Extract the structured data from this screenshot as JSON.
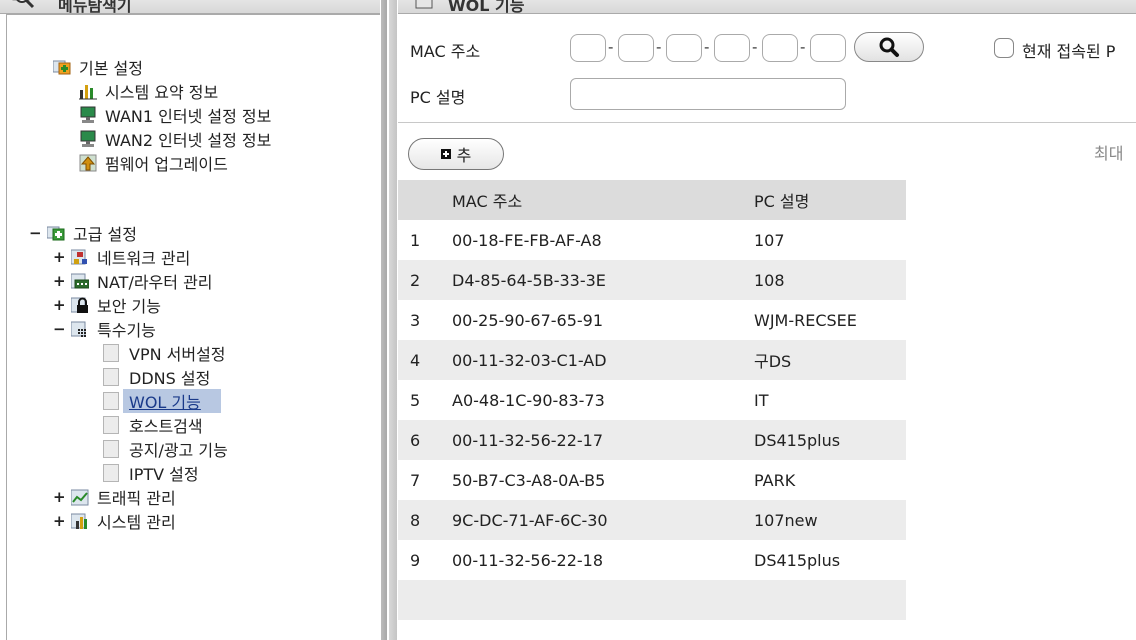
{
  "left_panel": {
    "title": "메뉴탐색기",
    "basic": {
      "label": "기본 설정",
      "items": [
        "시스템 요약 정보",
        "WAN1 인터넷 설정 정보",
        "WAN2 인터넷 설정 정보",
        "펌웨어 업그레이드"
      ]
    },
    "advanced": {
      "label": "고급 설정",
      "network": "네트워크 관리",
      "nat": "NAT/라우터 관리",
      "security": "보안 기능",
      "special": {
        "label": "특수기능",
        "items": [
          "VPN 서버설정",
          "DDNS 설정",
          "WOL 기능",
          "호스트검색",
          "공지/광고 기능",
          "IPTV 설정"
        ]
      },
      "traffic": "트래픽 관리",
      "system": "시스템 관리"
    }
  },
  "right_panel": {
    "title": "WOL 기능",
    "mac_label": "MAC 주소",
    "pc_label": "PC 설명",
    "connected_label": "현재 접속된 P",
    "add_label": "추",
    "max_label": "최대",
    "table": {
      "headers": [
        "MAC 주소",
        "PC 설명"
      ],
      "rows": [
        {
          "num": "1",
          "mac": "00-18-FE-FB-AF-A8",
          "desc": "107"
        },
        {
          "num": "2",
          "mac": "D4-85-64-5B-33-3E",
          "desc": "108"
        },
        {
          "num": "3",
          "mac": "00-25-90-67-65-91",
          "desc": "WJM-RECSEE"
        },
        {
          "num": "4",
          "mac": "00-11-32-03-C1-AD",
          "desc": "구DS"
        },
        {
          "num": "5",
          "mac": "A0-48-1C-90-83-73",
          "desc": "IT"
        },
        {
          "num": "6",
          "mac": "00-11-32-56-22-17",
          "desc": "DS415plus"
        },
        {
          "num": "7",
          "mac": "50-B7-C3-A8-0A-B5",
          "desc": "PARK"
        },
        {
          "num": "8",
          "mac": "9C-DC-71-AF-6C-30",
          "desc": "107new"
        },
        {
          "num": "9",
          "mac": "00-11-32-56-22-18",
          "desc": "DS415plus"
        }
      ]
    }
  },
  "colors": {
    "selected_bg": "#b8c8e2",
    "header_gray": "#dcdcdc",
    "row_alt": "#ececec"
  }
}
